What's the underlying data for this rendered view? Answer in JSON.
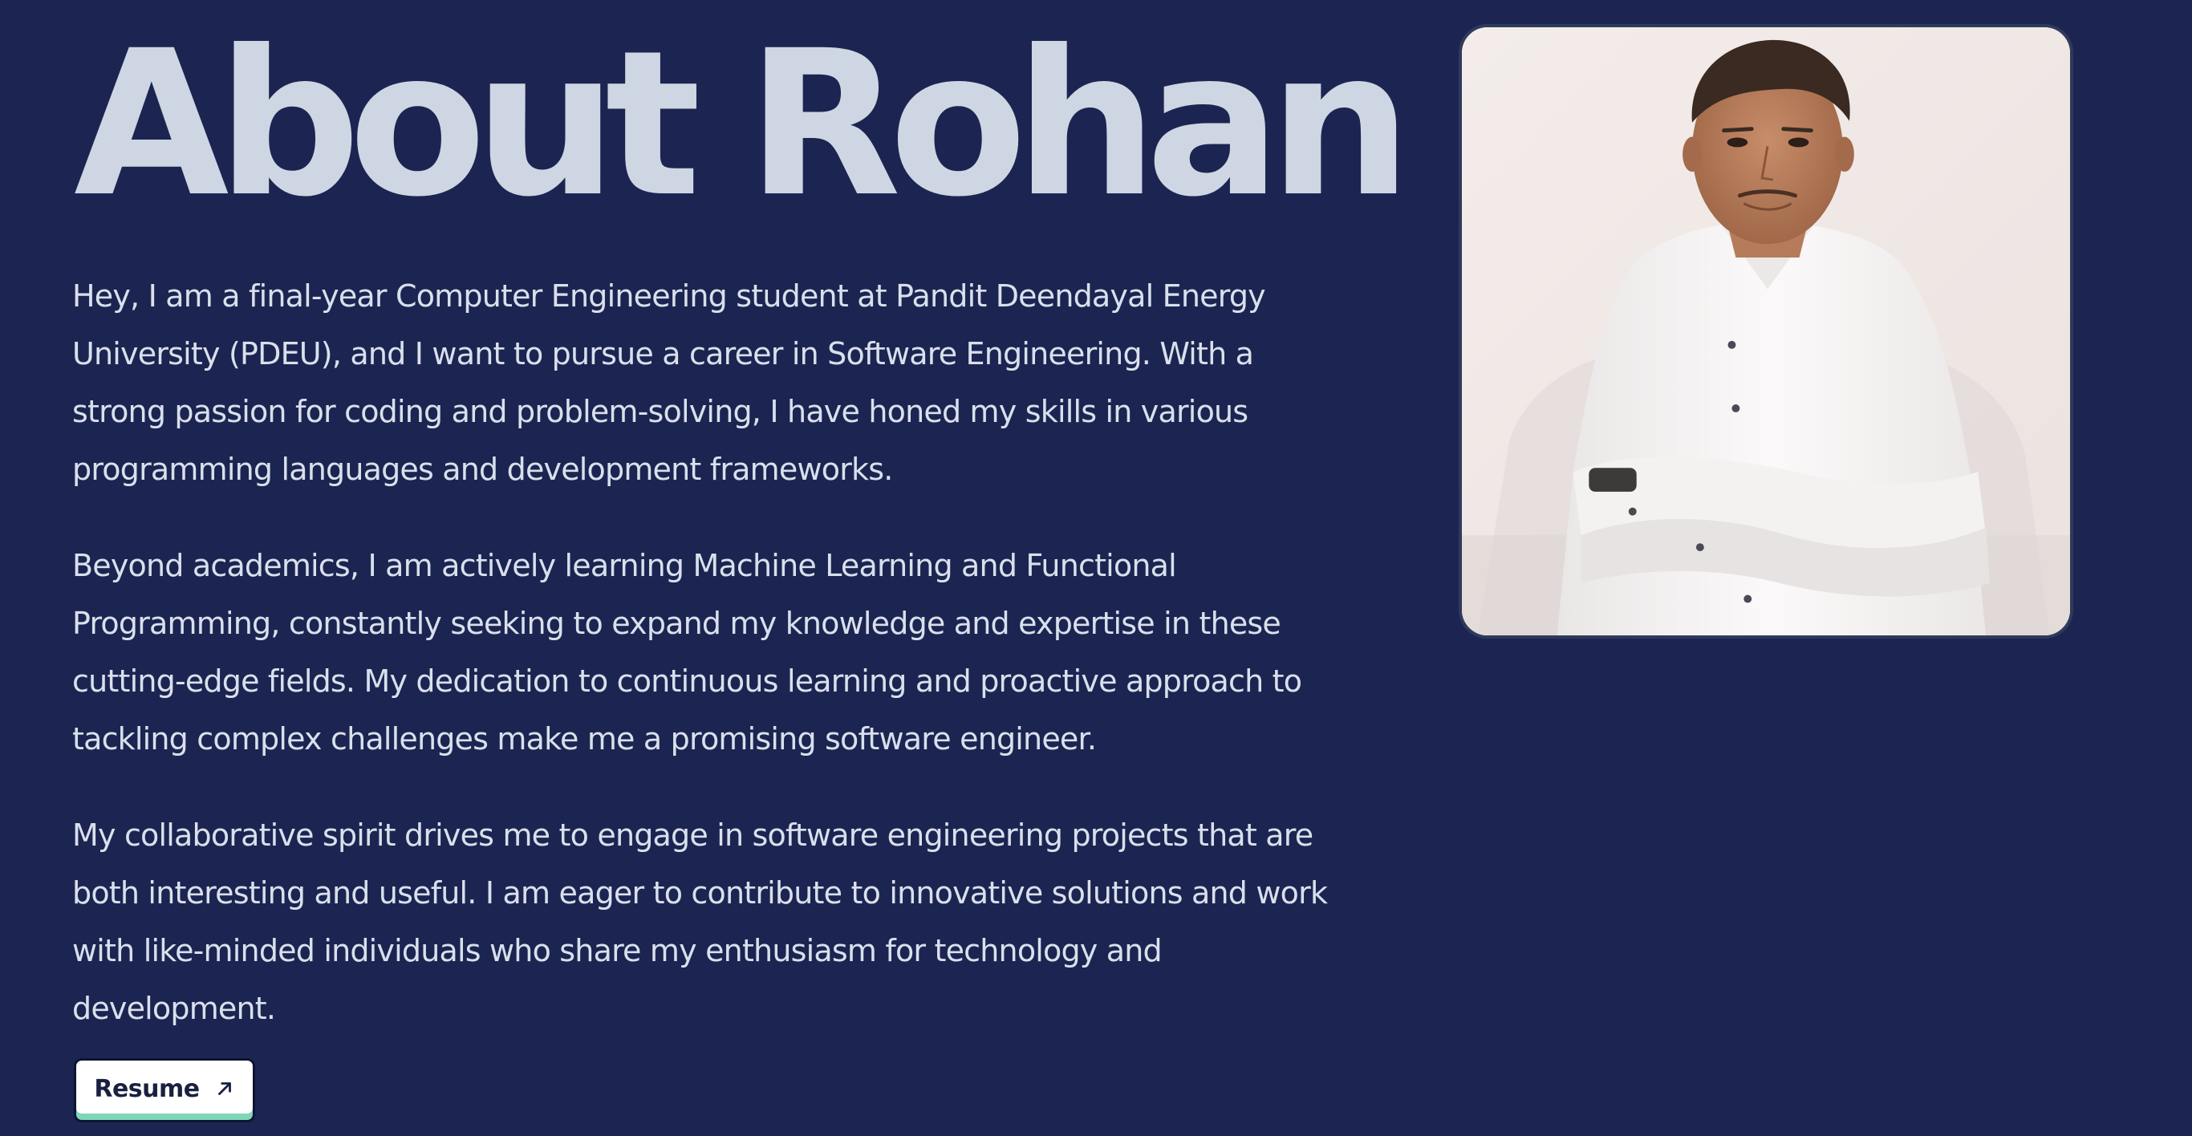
{
  "about": {
    "title": "About Rohan",
    "paragraphs": [
      "Hey, I am a final-year Computer Engineering student at Pandit Deendayal Energy University (PDEU), and I want to pursue a career in Software Engineering. With a strong passion for coding and problem-solving, I have honed my skills in various programming languages and development frameworks.",
      "Beyond academics, I am actively learning Machine Learning and Functional Programming, constantly seeking to expand my knowledge and expertise in these cutting-edge fields. My dedication to continuous learning and proactive approach to tackling complex challenges make me a promising software engineer.",
      "My collaborative spirit drives me to engage in software engineering projects that are both interesting and useful. I am eager to contribute to innovative solutions and work with like-minded individuals who share my enthusiasm for technology and development."
    ],
    "resume_label": "Resume",
    "resume_icon": "arrow-up-right-icon"
  },
  "photo": {
    "subject": "portrait-photo"
  },
  "colors": {
    "background": "#1c2551",
    "title": "#ced6e3",
    "body_text": "#d9e0ec",
    "button_bg": "#ffffff",
    "button_accent": "#7fd6b6"
  }
}
